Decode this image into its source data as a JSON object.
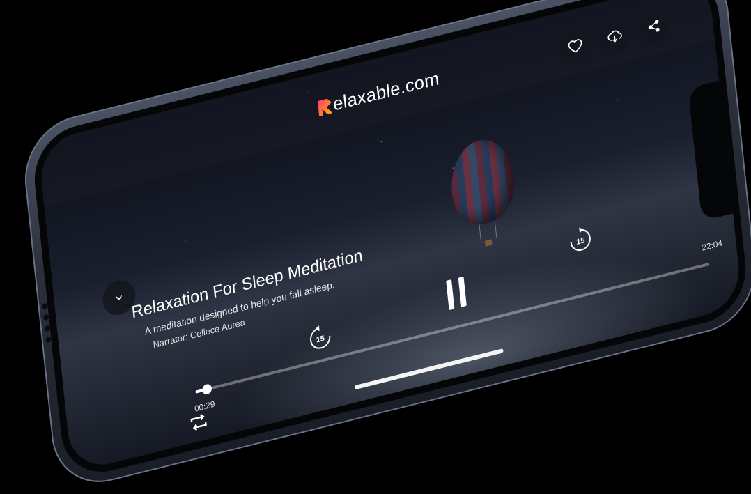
{
  "brand": {
    "name": "elaxable.com",
    "logo_letter": "R"
  },
  "header": {
    "favorite_label": "Favorite",
    "download_label": "Download",
    "share_label": "Share"
  },
  "track": {
    "title": "Relaxation For Sleep Meditation",
    "subtitle": "A meditation designed to help you fall asleep.",
    "narrator": "Narrator: Celiece Aurea"
  },
  "player": {
    "skip_back_seconds": "15",
    "skip_forward_seconds": "15",
    "elapsed": "00:29",
    "total": "22:04",
    "progress_fraction": 0.022
  },
  "icons": {
    "collapse": "chevron-down-icon",
    "favorite": "heart-icon",
    "download": "cloud-download-icon",
    "share": "share-icon",
    "pause": "pause-icon",
    "repeat": "repeat-icon"
  },
  "colors": {
    "accent": "#ffffff",
    "brand_gradient_start": "#ff3a7a",
    "brand_gradient_end": "#ffb000"
  }
}
